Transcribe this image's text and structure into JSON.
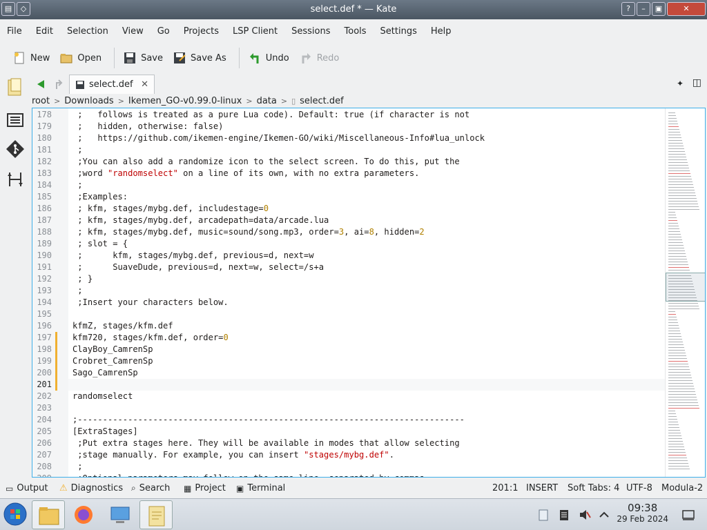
{
  "window": {
    "title": "select.def * — Kate"
  },
  "menu": [
    "File",
    "Edit",
    "Selection",
    "View",
    "Go",
    "Projects",
    "LSP Client",
    "Sessions",
    "Tools",
    "Settings",
    "Help"
  ],
  "toolbar": {
    "new": "New",
    "open": "Open",
    "save": "Save",
    "save_as": "Save As",
    "undo": "Undo",
    "redo": "Redo"
  },
  "tab": {
    "label": "select.def"
  },
  "breadcrumb": [
    "root",
    "Downloads",
    "Ikemen_GO-v0.99.0-linux",
    "data",
    "select.def"
  ],
  "editor": {
    "lines": [
      {
        "n": "178",
        "t": " ;   follows is treated as a pure Lua code). Default: true (if character is not"
      },
      {
        "n": "179",
        "t": " ;   hidden, otherwise: false)"
      },
      {
        "n": "180",
        "t": " ;   https://github.com/ikemen-engine/Ikemen-GO/wiki/Miscellaneous-Info#lua_unlock"
      },
      {
        "n": "181",
        "t": " ;"
      },
      {
        "n": "182",
        "t": " ;You can also add a randomize icon to the select screen. To do this, put the"
      },
      {
        "n": "183",
        "a": " ;word ",
        "s": "\"randomselect\"",
        "b": " on a line of its own, with no extra parameters."
      },
      {
        "n": "184",
        "t": " ;"
      },
      {
        "n": "185",
        "t": " ;Examples:"
      },
      {
        "n": "186",
        "a": " ; kfm, stages/mybg.def, includestage=",
        "num": "0"
      },
      {
        "n": "187",
        "t": " ; kfm, stages/mybg.def, arcadepath=data/arcade.lua"
      },
      {
        "n": "188",
        "a": " ; kfm, stages/mybg.def, music=sound/song.mp3, order=",
        "num": "3",
        "b": ", ai=",
        "num2": "8",
        "c": ", hidden=",
        "num3": "2"
      },
      {
        "n": "189",
        "t": " ; slot = {"
      },
      {
        "n": "190",
        "t": " ;      kfm, stages/mybg.def, previous=d, next=w"
      },
      {
        "n": "191",
        "t": " ;      SuaveDude, previous=d, next=w, select=/s+a"
      },
      {
        "n": "192",
        "t": " ; }"
      },
      {
        "n": "193",
        "t": " ;"
      },
      {
        "n": "194",
        "t": " ;Insert your characters below."
      },
      {
        "n": "195",
        "t": ""
      },
      {
        "n": "196",
        "t": "kfmZ, stages/kfm.def"
      },
      {
        "n": "197",
        "a": "kfm720, stages/kfm.def, order=",
        "num": "0"
      },
      {
        "n": "198",
        "t": "ClayBoy_CamrenSp"
      },
      {
        "n": "199",
        "t": "Crobret_CamrenSp"
      },
      {
        "n": "200",
        "t": "Sago_CamrenSp"
      },
      {
        "n": "201",
        "t": ""
      },
      {
        "n": "202",
        "t": "randomselect"
      },
      {
        "n": "203",
        "t": ""
      },
      {
        "n": "204",
        "t": ";-----------------------------------------------------------------------------"
      },
      {
        "n": "205",
        "t": "[ExtraStages]"
      },
      {
        "n": "206",
        "t": " ;Put extra stages here. They will be available in modes that allow selecting"
      },
      {
        "n": "207",
        "a": " ;stage manually. For example, you can insert ",
        "s": "\"stages/mybg.def\"",
        "b": "."
      },
      {
        "n": "208",
        "t": " ;"
      },
      {
        "n": "209",
        "t": " ;Optional parameters may follow on the same line, separated by commas"
      }
    ]
  },
  "statusbar": {
    "output": "Output",
    "diagnostics": "Diagnostics",
    "search": "Search",
    "project": "Project",
    "terminal": "Terminal",
    "cursor": "201:1",
    "mode": "INSERT",
    "tabs": "Soft Tabs: 4",
    "encoding": "UTF-8",
    "syntax": "Modula-2"
  },
  "clock": {
    "time": "09:38",
    "date": "29 Feb 2024"
  },
  "colors": {
    "accent": "#3daee9",
    "string": "#bf0303",
    "number": "#b08000",
    "modified": "#f0b030"
  }
}
